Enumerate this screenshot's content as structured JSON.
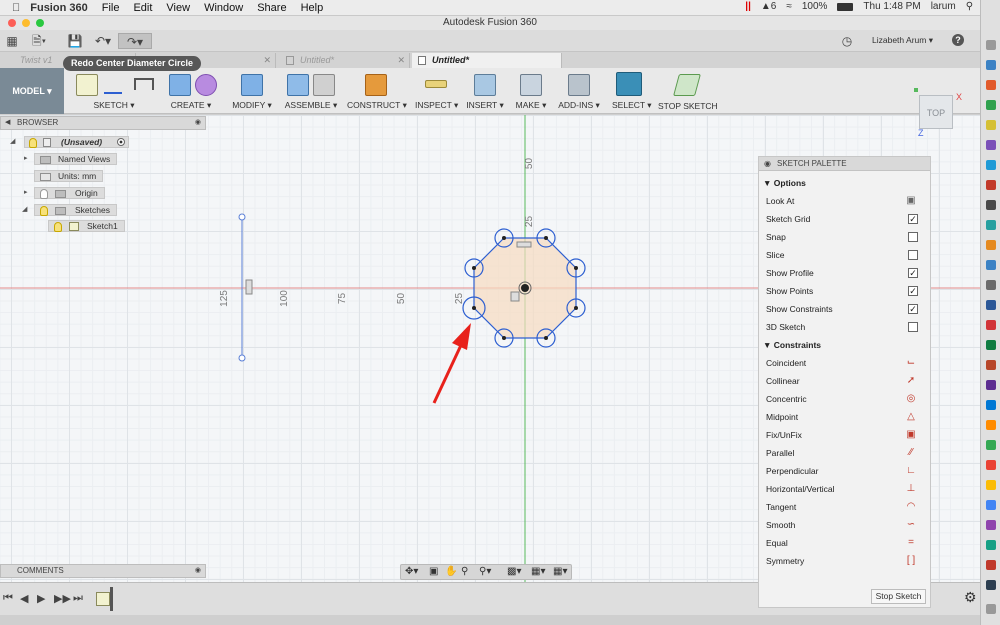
{
  "menubar": {
    "app_name": "Fusion 360",
    "menus": [
      "File",
      "Edit",
      "View",
      "Window",
      "Share",
      "Help"
    ],
    "status": {
      "badge_count": "6",
      "battery": "100%",
      "clock": "Thu 1:48 PM",
      "user": "larum"
    }
  },
  "window": {
    "title": "Autodesk Fusion 360"
  },
  "quick_access": {
    "user_name": "Lizabeth Arum",
    "help_label": "?"
  },
  "tooltip": {
    "text": "Redo Center Diameter Circle"
  },
  "tabs": [
    {
      "label": "Twist v1"
    },
    {
      "label": "Untitled*"
    },
    {
      "label": "Untitled*"
    }
  ],
  "ribbon": {
    "workspace": "MODEL",
    "groups": [
      "SKETCH",
      "CREATE",
      "MODIFY",
      "ASSEMBLE",
      "CONSTRUCT",
      "INSPECT",
      "INSERT",
      "MAKE",
      "ADD-INS",
      "SELECT",
      "STOP SKETCH"
    ]
  },
  "browser": {
    "header": "BROWSER",
    "items": [
      {
        "label": "(Unsaved)"
      },
      {
        "label": "Named Views"
      },
      {
        "label": "Units: mm"
      },
      {
        "label": "Origin"
      },
      {
        "label": "Sketches"
      },
      {
        "label": "Sketch1"
      }
    ]
  },
  "comments": {
    "header": "COMMENTS"
  },
  "viewcube": {
    "face": "TOP",
    "axis_x": "X",
    "axis_z": "Z"
  },
  "dimensions": {
    "vertical": [
      "50",
      "25"
    ],
    "horizontal": [
      "125",
      "100",
      "75",
      "50",
      "25"
    ]
  },
  "palette": {
    "title": "SKETCH PALETTE",
    "options_header": "Options",
    "options": [
      {
        "label": "Look At",
        "kind": "button"
      },
      {
        "label": "Sketch Grid",
        "checked": true
      },
      {
        "label": "Snap",
        "checked": false
      },
      {
        "label": "Slice",
        "checked": false
      },
      {
        "label": "Show Profile",
        "checked": true
      },
      {
        "label": "Show Points",
        "checked": true
      },
      {
        "label": "Show Constraints",
        "checked": true
      },
      {
        "label": "3D Sketch",
        "checked": false
      }
    ],
    "constraints_header": "Constraints",
    "constraints": [
      {
        "label": "Coincident",
        "icon": "coincident-icon"
      },
      {
        "label": "Collinear",
        "icon": "collinear-icon"
      },
      {
        "label": "Concentric",
        "icon": "concentric-icon"
      },
      {
        "label": "Midpoint",
        "icon": "midpoint-icon"
      },
      {
        "label": "Fix/UnFix",
        "icon": "lock-icon"
      },
      {
        "label": "Parallel",
        "icon": "parallel-icon"
      },
      {
        "label": "Perpendicular",
        "icon": "perpendicular-icon"
      },
      {
        "label": "Horizontal/Vertical",
        "icon": "horizontal-vertical-icon"
      },
      {
        "label": "Tangent",
        "icon": "tangent-icon"
      },
      {
        "label": "Smooth",
        "icon": "smooth-icon"
      },
      {
        "label": "Equal",
        "icon": "equal-icon"
      },
      {
        "label": "Symmetry",
        "icon": "symmetry-icon"
      }
    ],
    "stop_sketch_label": "Stop Sketch"
  },
  "colors": {
    "accent": "#3a7bd5",
    "sketch_line": "#2d5fd1",
    "profile_fill": "#f6dcc0",
    "annotation_arrow": "#e8211b",
    "axis_red": "#e48a8a",
    "axis_green": "#57b95d"
  }
}
